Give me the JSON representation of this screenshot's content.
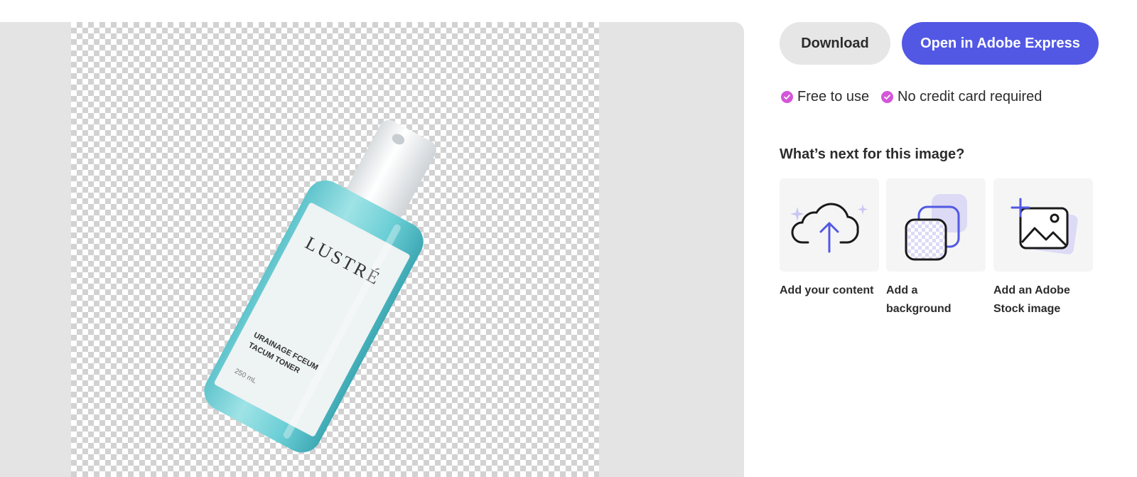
{
  "actions": {
    "download_label": "Download",
    "open_express_label": "Open in Adobe Express"
  },
  "perks": [
    {
      "label": "Free to use",
      "icon": "check-circle-icon"
    },
    {
      "label": "No credit card required",
      "icon": "check-circle-icon"
    }
  ],
  "next_steps": {
    "heading": "What’s next for this image?",
    "cards": [
      {
        "label": "Add your content",
        "icon": "cloud-upload-icon"
      },
      {
        "label": "Add a background",
        "icon": "background-layers-icon"
      },
      {
        "label": "Add an Adobe Stock image",
        "icon": "add-image-icon"
      }
    ]
  },
  "preview": {
    "brand": "LUSTRÉ",
    "product_line1": "URAINAGE FCEUM",
    "product_line2": "TACUM TONER",
    "volume": "250 mL"
  },
  "colors": {
    "accent": "#5258e4",
    "check": "#d356d8",
    "panel_bg": "#e4e4e4"
  }
}
